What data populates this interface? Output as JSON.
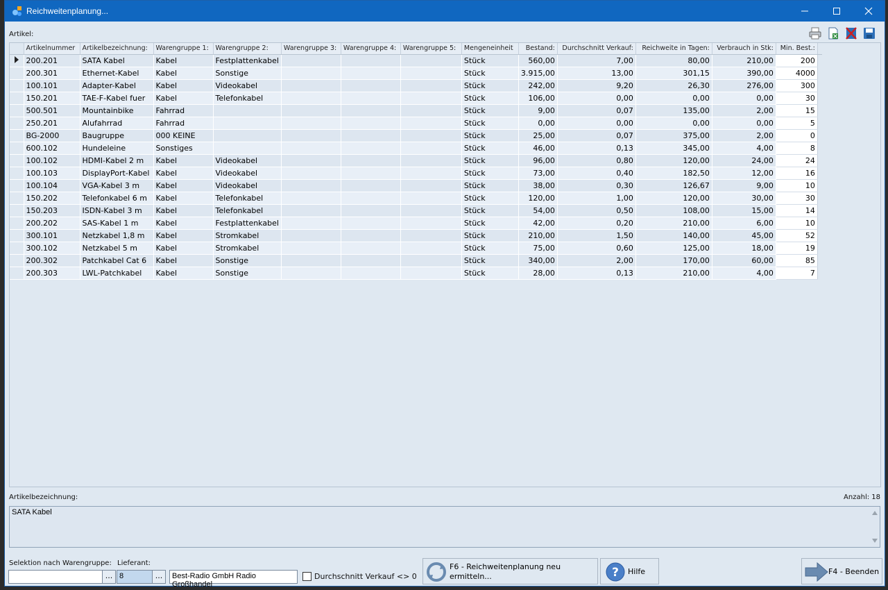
{
  "window": {
    "title": "Reichweitenplanung...",
    "minimize_icon": "minimize-icon",
    "maximize_icon": "maximize-icon",
    "close_icon": "close-icon"
  },
  "grid": {
    "label": "Artikel:",
    "columns": [
      "Artikelnummer",
      "Artikelbezeichnung:",
      "Warengruppe 1:",
      "Warengruppe 2:",
      "Warengruppe 3:",
      "Warengruppe 4:",
      "Warengruppe 5:",
      "Mengeneinheit",
      "Bestand:",
      "Durchschnitt Verkauf:",
      "Reichweite in Tagen:",
      "Verbrauch in Stk:",
      "Min. Best.:"
    ],
    "rows": [
      [
        "200.201",
        "SATA Kabel",
        "Kabel",
        "Festplattenkabel",
        "",
        "",
        "",
        "Stück",
        "560,00",
        "7,00",
        "80,00",
        "210,00",
        "200"
      ],
      [
        "200.301",
        "Ethernet-Kabel",
        "Kabel",
        "Sonstige",
        "",
        "",
        "",
        "Stück",
        "3.915,00",
        "13,00",
        "301,15",
        "390,00",
        "4000"
      ],
      [
        "100.101",
        "Adapter-Kabel",
        "Kabel",
        "Videokabel",
        "",
        "",
        "",
        "Stück",
        "242,00",
        "9,20",
        "26,30",
        "276,00",
        "300"
      ],
      [
        "150.201",
        "TAE-F-Kabel fuer",
        "Kabel",
        "Telefonkabel",
        "",
        "",
        "",
        "Stück",
        "106,00",
        "0,00",
        "0,00",
        "0,00",
        "30"
      ],
      [
        "500.501",
        "Mountainbike",
        "Fahrrad",
        "",
        "",
        "",
        "",
        "Stück",
        "9,00",
        "0,07",
        "135,00",
        "2,00",
        "15"
      ],
      [
        "250.201",
        "Alufahrrad",
        "Fahrrad",
        "",
        "",
        "",
        "",
        "Stück",
        "0,00",
        "0,00",
        "0,00",
        "0,00",
        "5"
      ],
      [
        "BG-2000",
        "Baugruppe",
        "000 KEINE",
        "",
        "",
        "",
        "",
        "Stück",
        "25,00",
        "0,07",
        "375,00",
        "2,00",
        "0"
      ],
      [
        "600.102",
        "Hundeleine",
        "Sonstiges",
        "",
        "",
        "",
        "",
        "Stück",
        "46,00",
        "0,13",
        "345,00",
        "4,00",
        "8"
      ],
      [
        "100.102",
        "HDMI-Kabel 2 m",
        "Kabel",
        "Videokabel",
        "",
        "",
        "",
        "Stück",
        "96,00",
        "0,80",
        "120,00",
        "24,00",
        "24"
      ],
      [
        "100.103",
        "DisplayPort-Kabel",
        "Kabel",
        "Videokabel",
        "",
        "",
        "",
        "Stück",
        "73,00",
        "0,40",
        "182,50",
        "12,00",
        "16"
      ],
      [
        "100.104",
        "VGA-Kabel 3 m",
        "Kabel",
        "Videokabel",
        "",
        "",
        "",
        "Stück",
        "38,00",
        "0,30",
        "126,67",
        "9,00",
        "10"
      ],
      [
        "150.202",
        "Telefonkabel 6 m",
        "Kabel",
        "Telefonkabel",
        "",
        "",
        "",
        "Stück",
        "120,00",
        "1,00",
        "120,00",
        "30,00",
        "30"
      ],
      [
        "150.203",
        "ISDN-Kabel 3 m",
        "Kabel",
        "Telefonkabel",
        "",
        "",
        "",
        "Stück",
        "54,00",
        "0,50",
        "108,00",
        "15,00",
        "14"
      ],
      [
        "200.202",
        "SAS-Kabel 1 m",
        "Kabel",
        "Festplattenkabel",
        "",
        "",
        "",
        "Stück",
        "42,00",
        "0,20",
        "210,00",
        "6,00",
        "10"
      ],
      [
        "300.101",
        "Netzkabel 1,8 m",
        "Kabel",
        "Stromkabel",
        "",
        "",
        "",
        "Stück",
        "210,00",
        "1,50",
        "140,00",
        "45,00",
        "52"
      ],
      [
        "300.102",
        "Netzkabel 5 m",
        "Kabel",
        "Stromkabel",
        "",
        "",
        "",
        "Stück",
        "75,00",
        "0,60",
        "125,00",
        "18,00",
        "19"
      ],
      [
        "200.302",
        "Patchkabel Cat 6",
        "Kabel",
        "Sonstige",
        "",
        "",
        "",
        "Stück",
        "340,00",
        "2,00",
        "170,00",
        "60,00",
        "85"
      ],
      [
        "200.303",
        "LWL-Patchkabel",
        "Kabel",
        "Sonstige",
        "",
        "",
        "",
        "Stück",
        "28,00",
        "0,13",
        "210,00",
        "4,00",
        "7"
      ]
    ]
  },
  "detail": {
    "label": "Artikelbezeichnung:",
    "count": "Anzahl: 18",
    "text": "SATA Kabel"
  },
  "filters": {
    "warengruppe_label": "Selektion nach Warengruppe:",
    "warengruppe_value": "",
    "lieferant_label": "Lieferant:",
    "lieferant_value": "8",
    "lieferant_name": "Best-Radio GmbH Radio Großhandel",
    "dots": "...",
    "checkbox_label": "Durchschnitt Verkauf <> 0",
    "checkbox_checked": false
  },
  "buttons": {
    "recalc": "F6 - Reichweitenplanung neu ermitteln...",
    "help": "Hilfe",
    "exit": "F4 - Beenden"
  },
  "colors": {
    "titlebar": "#1067c0",
    "window_bg": "#dfe8f1"
  }
}
